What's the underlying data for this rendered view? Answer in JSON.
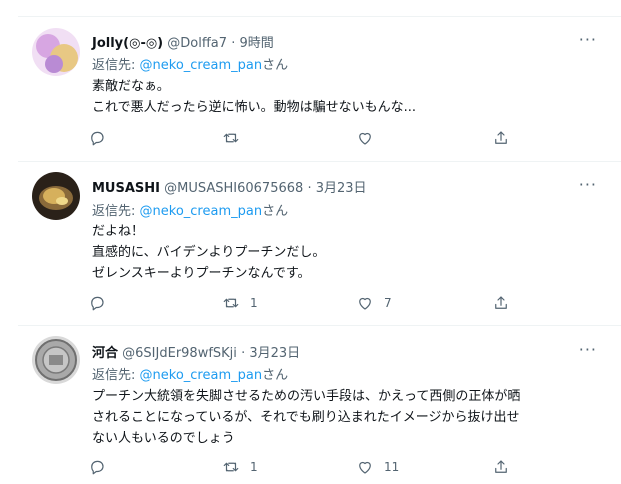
{
  "tweets": [
    {
      "name": "Jolly(◎-◎)",
      "handle": "@Dolffa7",
      "dot": "·",
      "time": "9時間",
      "reply_prefix": "返信先: ",
      "reply_to": "@neko_cream_pan",
      "reply_suffix": "さん",
      "lines": [
        "素敵だなぁ。",
        "これで悪人だったら逆に怖い。動物は騙せないもんな..."
      ],
      "reply_count": "",
      "retweet_count": "",
      "like_count": "",
      "avatar_colors": [
        "#f3d6f6",
        "#c58ed3",
        "#e9c67a"
      ]
    },
    {
      "name": "MUSASHI",
      "handle": "@MUSASHI60675668",
      "dot": "·",
      "time": "3月23日",
      "reply_prefix": "返信先: ",
      "reply_to": "@neko_cream_pan",
      "reply_suffix": "さん",
      "lines": [
        "だよね！",
        "直感的に、バイデンよりプーチンだし。",
        "ゼレンスキーよりプーチンなんです。"
      ],
      "reply_count": "",
      "retweet_count": "1",
      "like_count": "7",
      "avatar_colors": [
        "#2b2218",
        "#c9a14e",
        "#6b5230"
      ]
    },
    {
      "name": "河合",
      "handle": "@6SIJdEr98wfSKji",
      "dot": "·",
      "time": "3月23日",
      "reply_prefix": "返信先: ",
      "reply_to": "@neko_cream_pan",
      "reply_suffix": "さん",
      "lines": [
        "プーチン大統領を失脚させるための汚い手段は、かえって西側の正体が晒",
        "されることになっているが、それでも刷り込まれたイメージから抜け出せ",
        "ない人もいるのでしょう"
      ],
      "reply_count": "",
      "retweet_count": "1",
      "like_count": "11",
      "avatar_colors": [
        "#b8b8b8",
        "#6e6e6e",
        "#dcdcdc"
      ]
    }
  ],
  "more_label": "···",
  "icons": {
    "reply": "reply-icon",
    "retweet": "retweet-icon",
    "like": "heart-icon",
    "share": "share-icon",
    "more": "more-icon"
  }
}
